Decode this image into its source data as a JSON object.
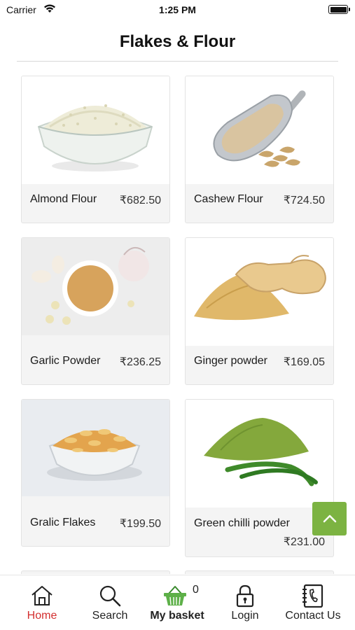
{
  "status_bar": {
    "carrier": "Carrier",
    "time": "1:25 PM"
  },
  "header": {
    "title": "Flakes & Flour"
  },
  "products": [
    {
      "name": "Almond Flour",
      "price": "₹682.50",
      "image": "almond-flour-bowl"
    },
    {
      "name": "Cashew Flour",
      "price": "₹724.50",
      "image": "cashew-flour-scoop"
    },
    {
      "name": "Garlic Powder",
      "price": "₹236.25",
      "image": "garlic-powder-bowl"
    },
    {
      "name": "Ginger powder",
      "price": "₹169.05",
      "image": "ginger-powder"
    },
    {
      "name": "Gralic Flakes",
      "price": "₹199.50",
      "image": "garlic-flakes-bowl"
    },
    {
      "name": "Green chilli powder",
      "price": "₹231.00",
      "image": "green-chilli-powder"
    }
  ],
  "scroll_top": {
    "icon": "chevron-up-icon"
  },
  "tab_bar": {
    "tabs": [
      {
        "label": "Home",
        "icon": "home-icon",
        "active": true
      },
      {
        "label": "Search",
        "icon": "search-icon",
        "active": false
      },
      {
        "label": "My basket",
        "icon": "basket-icon",
        "active": false,
        "badge": "0"
      },
      {
        "label": "Login",
        "icon": "lock-icon",
        "active": false
      },
      {
        "label": "Contact Us",
        "icon": "phone-book-icon",
        "active": false
      }
    ]
  },
  "colors": {
    "accent_green": "#7cb342",
    "active_tab": "#d32f2f",
    "card_bg": "#f4f4f4"
  }
}
